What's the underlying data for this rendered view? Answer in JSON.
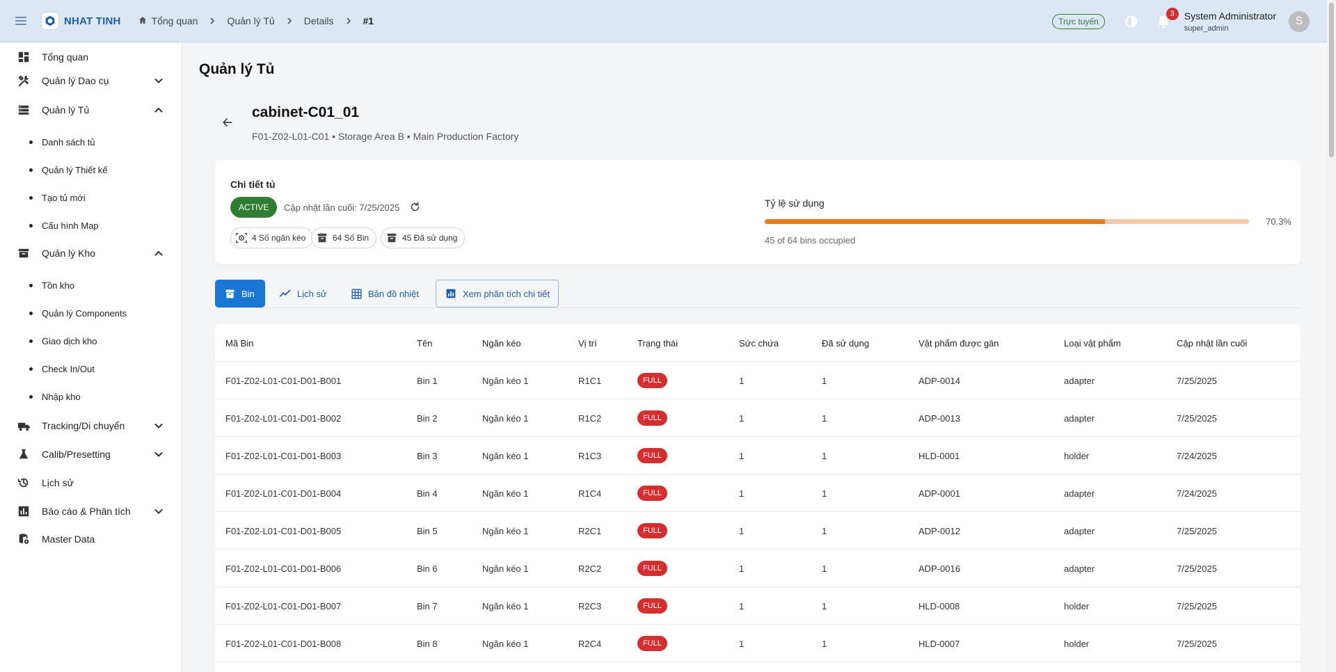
{
  "brand": {
    "name": "NHAT TINH"
  },
  "breadcrumbs": [
    {
      "label": "Tổng quan",
      "home": true
    },
    {
      "label": "Quản lý Tủ"
    },
    {
      "label": "Details"
    },
    {
      "label": "#1",
      "current": true
    }
  ],
  "topbar": {
    "online_label": "Trực tuyến",
    "notification_count": "3",
    "user_name": "System Administrator",
    "user_role": "super_admin",
    "avatar_letter": "S"
  },
  "sidebar": {
    "items": [
      {
        "label": "Tổng quan",
        "icon": "dashboard-icon"
      },
      {
        "label": "Quản lý Dao cụ",
        "icon": "tools-icon",
        "chevron": "down"
      },
      {
        "label": "Quản lý Tủ",
        "icon": "list-icon",
        "chevron": "up"
      },
      {
        "label": "Danh sách tủ",
        "sub": true
      },
      {
        "label": "Quản lý Thiết kế",
        "sub": true
      },
      {
        "label": "Tạo tủ mới",
        "sub": true
      },
      {
        "label": "Cấu hình Map",
        "sub": true
      },
      {
        "label": "Quản lý Kho",
        "icon": "archive-icon",
        "chevron": "up"
      },
      {
        "label": "Tồn kho",
        "sub": true
      },
      {
        "label": "Quản lý Components",
        "sub": true
      },
      {
        "label": "Giao dịch kho",
        "sub": true
      },
      {
        "label": "Check In/Out",
        "sub": true
      },
      {
        "label": "Nhập kho",
        "sub": true
      },
      {
        "label": "Tracking/Di chuyển",
        "icon": "truck-icon",
        "chevron": "down"
      },
      {
        "label": "Calib/Presetting",
        "icon": "flask-icon",
        "chevron": "down"
      },
      {
        "label": "Lịch sử",
        "icon": "history-icon"
      },
      {
        "label": "Báo cáo & Phân tích",
        "icon": "chart-icon",
        "chevron": "down"
      },
      {
        "label": "Master Data",
        "icon": "database-icon"
      }
    ]
  },
  "page": {
    "title": "Quản lý Tủ",
    "cabinet_name": "cabinet-C01_01",
    "cabinet_path": "F01-Z02-L01-C01 • Storage Area B • Main Production Factory"
  },
  "details": {
    "title": "Chi tiết tủ",
    "status": "ACTIVE",
    "updated": "Cập nhật lần cuối: 7/25/2025",
    "stats": [
      {
        "label": "4 Số ngăn kéo",
        "icon": "drawer-scan-icon"
      },
      {
        "label": "64 Số Bin",
        "icon": "bin-icon"
      },
      {
        "label": "45 Đã sử dụng",
        "icon": "bin-used-icon"
      }
    ],
    "usage_title": "Tỷ lệ sử dụng",
    "usage_percent": 70.3,
    "usage_percent_label": "70.3%",
    "usage_sub": "45 of 64 bins occupied",
    "colors": {
      "usage_fill": "#e47a24",
      "usage_track": "#f4c9a8",
      "status": "#2e7d32",
      "full_badge": "#d32f2f",
      "primary": "#1976d2"
    }
  },
  "tabs": [
    {
      "label": "Bin",
      "icon": "bin-icon",
      "active": true
    },
    {
      "label": "Lịch sử",
      "icon": "trend-icon"
    },
    {
      "label": "Bản đồ nhiệt",
      "icon": "grid-icon"
    },
    {
      "label": "Xem phân tích chi tiết",
      "icon": "analytics-icon",
      "outlined": true
    }
  ],
  "table": {
    "headers": [
      "Mã Bin",
      "Tên",
      "Ngăn kéo",
      "Vị trí",
      "Trạng thái",
      "Sức chứa",
      "Đã sử dụng",
      "Vật phẩm được gán",
      "Loại vật phẩm",
      "Cập nhật lần cuối"
    ],
    "rows": [
      [
        "F01-Z02-L01-C01-D01-B001",
        "Bin 1",
        "Ngăn kéo 1",
        "R1C1",
        "FULL",
        "1",
        "1",
        "ADP-0014",
        "adapter",
        "7/25/2025"
      ],
      [
        "F01-Z02-L01-C01-D01-B002",
        "Bin 2",
        "Ngăn kéo 1",
        "R1C2",
        "FULL",
        "1",
        "1",
        "ADP-0013",
        "adapter",
        "7/25/2025"
      ],
      [
        "F01-Z02-L01-C01-D01-B003",
        "Bin 3",
        "Ngăn kéo 1",
        "R1C3",
        "FULL",
        "1",
        "1",
        "HLD-0001",
        "holder",
        "7/24/2025"
      ],
      [
        "F01-Z02-L01-C01-D01-B004",
        "Bin 4",
        "Ngăn kéo 1",
        "R1C4",
        "FULL",
        "1",
        "1",
        "ADP-0001",
        "adapter",
        "7/24/2025"
      ],
      [
        "F01-Z02-L01-C01-D01-B005",
        "Bin 5",
        "Ngăn kéo 1",
        "R2C1",
        "FULL",
        "1",
        "1",
        "ADP-0012",
        "adapter",
        "7/25/2025"
      ],
      [
        "F01-Z02-L01-C01-D01-B006",
        "Bin 6",
        "Ngăn kéo 1",
        "R2C2",
        "FULL",
        "1",
        "1",
        "ADP-0016",
        "adapter",
        "7/25/2025"
      ],
      [
        "F01-Z02-L01-C01-D01-B007",
        "Bin 7",
        "Ngăn kéo 1",
        "R2C3",
        "FULL",
        "1",
        "1",
        "HLD-0008",
        "holder",
        "7/25/2025"
      ],
      [
        "F01-Z02-L01-C01-D01-B008",
        "Bin 8",
        "Ngăn kéo 1",
        "R2C4",
        "FULL",
        "1",
        "1",
        "HLD-0007",
        "holder",
        "7/25/2025"
      ]
    ]
  }
}
